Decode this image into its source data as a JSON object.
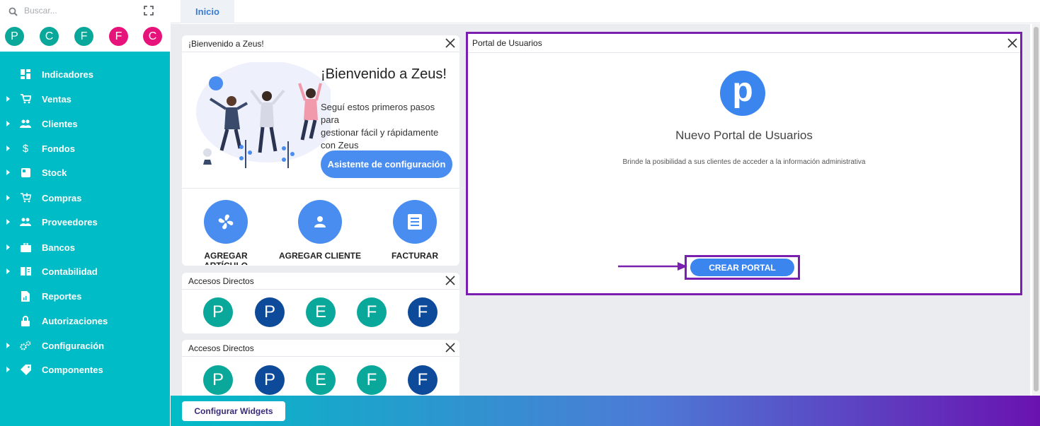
{
  "search": {
    "placeholder": "Buscar..."
  },
  "quick_avatars": [
    {
      "letter": "P",
      "color": "#0aa89a"
    },
    {
      "letter": "C",
      "color": "#0aa89a"
    },
    {
      "letter": "F",
      "color": "#0aa89a"
    },
    {
      "letter": "F",
      "color": "#e6137a"
    },
    {
      "letter": "C",
      "color": "#e6137a"
    }
  ],
  "sidebar": {
    "items": [
      {
        "label": "Indicadores",
        "icon": "dashboard-icon"
      },
      {
        "label": "Ventas",
        "icon": "cart-icon"
      },
      {
        "label": "Clientes",
        "icon": "people-icon"
      },
      {
        "label": "Fondos",
        "icon": "dollar-icon"
      },
      {
        "label": "Stock",
        "icon": "box-icon"
      },
      {
        "label": "Compras",
        "icon": "shopping-cart-icon"
      },
      {
        "label": "Proveedores",
        "icon": "people-icon"
      },
      {
        "label": "Bancos",
        "icon": "briefcase-icon"
      },
      {
        "label": "Contabilidad",
        "icon": "book-icon"
      },
      {
        "label": "Reportes",
        "icon": "report-icon"
      },
      {
        "label": "Autorizaciones",
        "icon": "lock-icon"
      },
      {
        "label": "Configuración",
        "icon": "gears-icon"
      },
      {
        "label": "Componentes",
        "icon": "tag-icon"
      }
    ]
  },
  "tabs": {
    "home": "Inicio"
  },
  "welcome": {
    "header": "¡Bienvenido a Zeus!",
    "heading": "¡Bienvenido a Zeus!",
    "line1": "Seguí estos primeros pasos",
    "line2": "para",
    "line3": "gestionar fácil y rápidamente",
    "line4": "con Zeus",
    "button": "Asistente de configuración",
    "actions": [
      "AGREGAR ARTÍCULO",
      "AGREGAR CLIENTE",
      "FACTURAR"
    ]
  },
  "shortcuts1": {
    "header": "Accesos Directos",
    "items": [
      {
        "letter": "P",
        "color": "#0aa89a"
      },
      {
        "letter": "P",
        "color": "#0d4b9a"
      },
      {
        "letter": "E",
        "color": "#0aa89a"
      },
      {
        "letter": "F",
        "color": "#0aa89a"
      },
      {
        "letter": "F",
        "color": "#0d4b9a"
      }
    ]
  },
  "shortcuts2": {
    "header": "Accesos Directos",
    "items": [
      {
        "letter": "P",
        "color": "#0aa89a"
      },
      {
        "letter": "P",
        "color": "#0d4b9a"
      },
      {
        "letter": "E",
        "color": "#0aa89a"
      },
      {
        "letter": "F",
        "color": "#0aa89a"
      },
      {
        "letter": "F",
        "color": "#0d4b9a"
      }
    ]
  },
  "portal": {
    "header": "Portal de Usuarios",
    "logo_letter": "p",
    "title": "Nuevo Portal de Usuarios",
    "description": "Brinde la posibilidad a sus clientes de acceder a la información administrativa",
    "button": "CREAR PORTAL"
  },
  "footer": {
    "config_button": "Configurar Widgets"
  },
  "colors": {
    "sidebar": "#00bcc6",
    "accent": "#4a8df0",
    "highlight": "#7a1fb0"
  }
}
